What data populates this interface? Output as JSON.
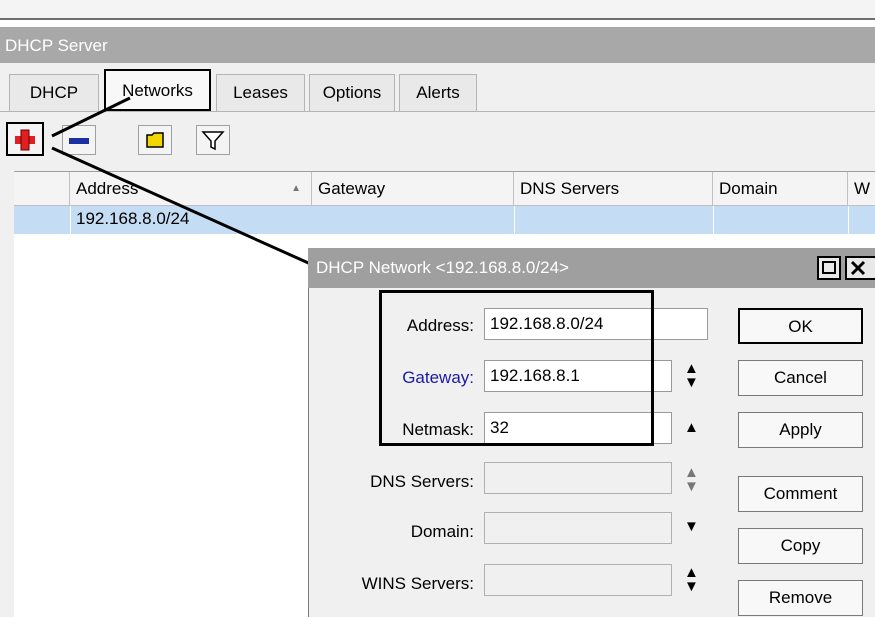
{
  "window": {
    "title": "DHCP Server"
  },
  "tabs": [
    {
      "label": "DHCP"
    },
    {
      "label": "Networks"
    },
    {
      "label": "Leases"
    },
    {
      "label": "Options"
    },
    {
      "label": "Alerts"
    }
  ],
  "toolbar": {
    "add_icon": "plus-icon",
    "remove_icon": "minus-icon",
    "comment_icon": "folder-note-icon",
    "filter_icon": "funnel-icon"
  },
  "table": {
    "columns": [
      "Address",
      "Gateway",
      "DNS Servers",
      "Domain",
      "W"
    ],
    "sort_indicator": "▲",
    "rows": [
      {
        "address": "192.168.8.0/24",
        "gateway": "",
        "dns_servers": "",
        "domain": ""
      }
    ]
  },
  "dialog": {
    "title": "DHCP Network <192.168.8.0/24>",
    "fields": {
      "address": {
        "label": "Address:",
        "value": "192.168.8.0/24"
      },
      "gateway": {
        "label": "Gateway:",
        "value": "192.168.8.1"
      },
      "netmask": {
        "label": "Netmask:",
        "value": "32"
      },
      "dns_servers": {
        "label": "DNS Servers:",
        "value": ""
      },
      "domain": {
        "label": "Domain:",
        "value": ""
      },
      "wins_servers": {
        "label": "WINS Servers:",
        "value": ""
      }
    },
    "buttons": {
      "ok": "OK",
      "cancel": "Cancel",
      "apply": "Apply",
      "comment": "Comment",
      "copy": "Copy",
      "remove": "Remove"
    },
    "gateway_label_color": "#1a1aa6"
  },
  "colors": {
    "selected_row": "#c4dcf4",
    "titlebar": "#a8a8a8",
    "add_icon": "#e02020",
    "remove_icon": "#1a2fa0",
    "comment_icon": "#f2d600"
  }
}
